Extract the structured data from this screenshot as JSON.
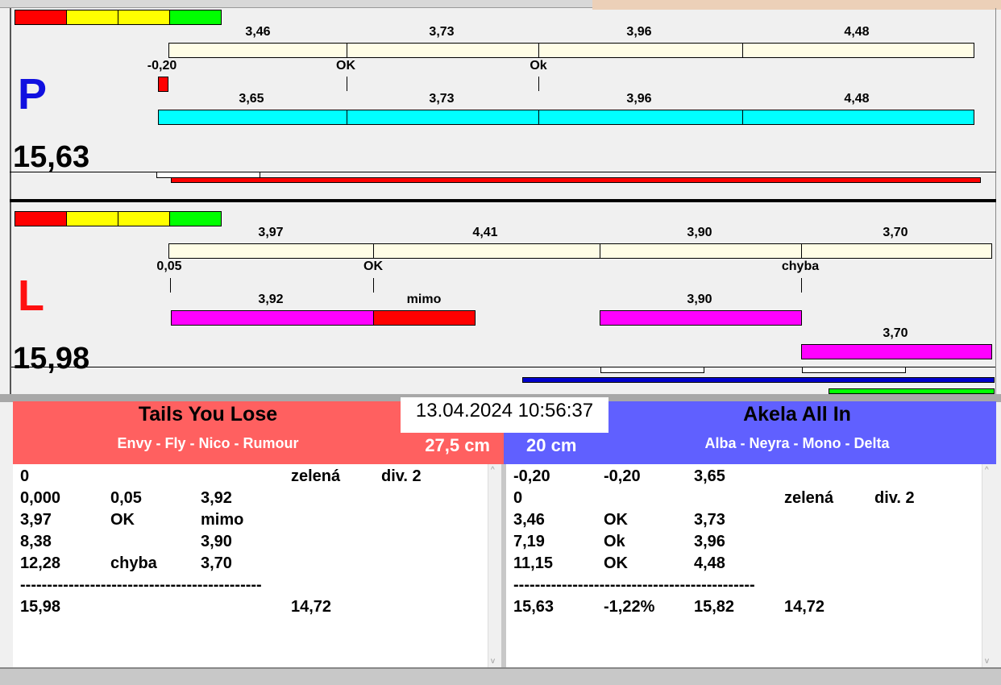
{
  "colors": {
    "red": "#ff0000",
    "yellow": "#ffff00",
    "green": "#00ff00",
    "cream": "#fffde6",
    "cyan": "#00ffff",
    "magenta": "#ff00ff",
    "blue": "#0000cc",
    "team_left": "#ff6060",
    "team_right": "#6060ff"
  },
  "top": {
    "letter": "P",
    "total": "15,63",
    "row1_labels": [
      "3,46",
      "3,73",
      "3,96",
      "4,48"
    ],
    "row2_labels": [
      "-0,20",
      "OK",
      "Ok"
    ],
    "row3_labels": [
      "3,65",
      "3,73",
      "3,96",
      "4,48"
    ]
  },
  "bottom": {
    "letter": "L",
    "total": "15,98",
    "row1_labels": [
      "3,97",
      "4,41",
      "3,90",
      "3,70"
    ],
    "row2_labels": [
      "0,05",
      "OK",
      "chyba"
    ],
    "row3_labels": [
      "3,92",
      "mimo",
      "3,90"
    ],
    "row4_labels": [
      "3,70"
    ]
  },
  "datetime": "13.04.2024 10:56:37",
  "left_team": {
    "name": "Tails You Lose",
    "dogs": "Envy - Fly - Nico - Rumour",
    "distance": "27,5 cm",
    "rows": [
      [
        "0",
        "",
        "",
        "zelená",
        "div. 2"
      ],
      [
        "0,000",
        "0,05",
        "3,92",
        "",
        ""
      ],
      [
        "3,97",
        "OK",
        "mimo",
        "",
        ""
      ],
      [
        "8,38",
        "",
        "3,90",
        "",
        ""
      ],
      [
        "12,28",
        "chyba",
        "3,70",
        "",
        ""
      ],
      [
        "---------------------------------------------",
        "",
        "",
        "",
        ""
      ],
      [
        "15,98",
        "",
        "",
        "14,72",
        ""
      ]
    ]
  },
  "right_team": {
    "name": "Akela All In",
    "dogs": "Alba - Neyra - Mono - Delta",
    "distance": "20 cm",
    "rows": [
      [
        "-0,20",
        "-0,20",
        "3,65",
        "",
        ""
      ],
      [
        "0",
        "",
        "",
        "zelená",
        "div. 2"
      ],
      [
        "3,46",
        "OK",
        "3,73",
        "",
        ""
      ],
      [
        "7,19",
        "Ok",
        "3,96",
        "",
        ""
      ],
      [
        "11,15",
        "OK",
        "4,48",
        "",
        ""
      ],
      [
        "---------------------------------------------",
        "",
        "",
        "",
        ""
      ],
      [
        "15,63",
        "-1,22%",
        "15,82",
        "14,72",
        ""
      ]
    ]
  }
}
